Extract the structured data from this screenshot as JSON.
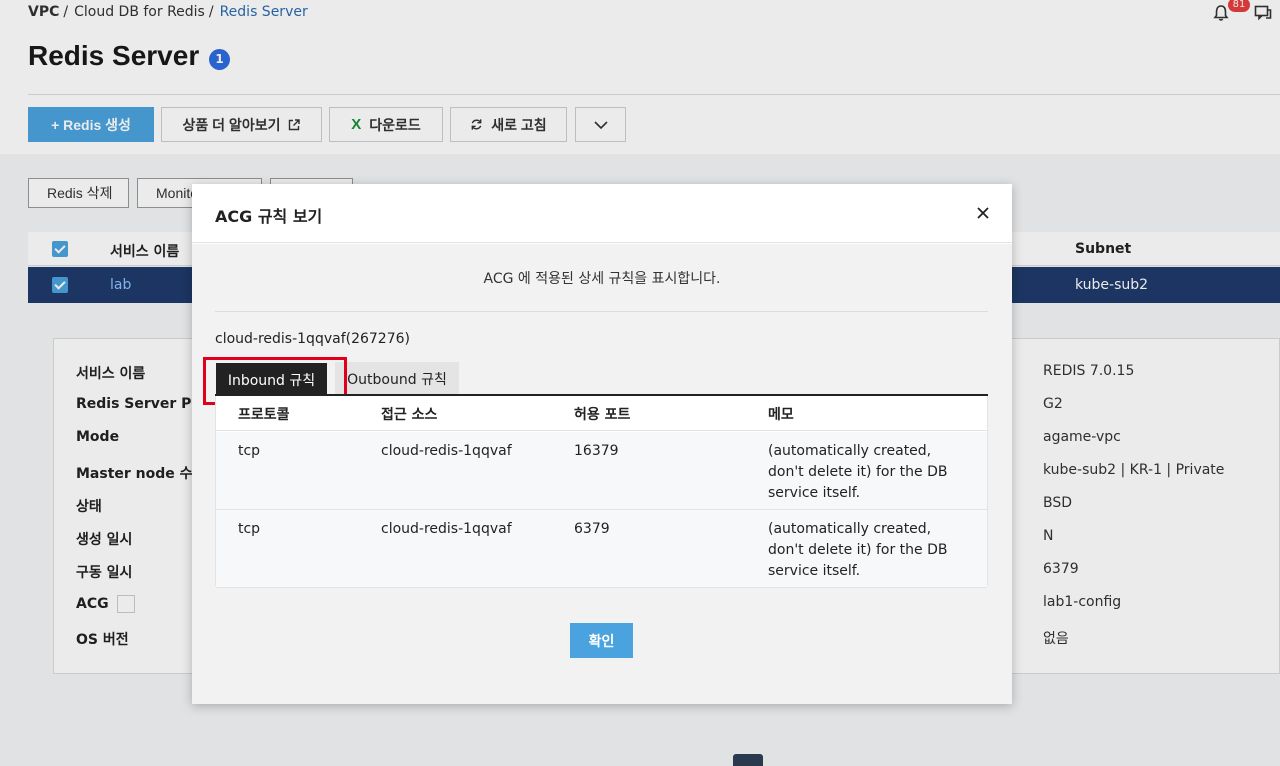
{
  "breadcrumb": {
    "items": [
      "VPC",
      "Cloud DB for Redis"
    ],
    "current": "Redis Server",
    "sep": "/"
  },
  "notifications": {
    "count": "81"
  },
  "page": {
    "title": "Redis Server",
    "title_badge": "1"
  },
  "toolbar": {
    "create": "+ Redis 생성",
    "learn_more": "상품 더 알아보기",
    "download_icon": "X",
    "download": "다운로드",
    "refresh": "새로 고침"
  },
  "subtoolbar": {
    "delete": "Redis 삭제",
    "monitoring": "Monito"
  },
  "list": {
    "headers": {
      "service_name": "서비스 이름",
      "subnet": "Subnet"
    },
    "rows": [
      {
        "name": "lab",
        "subnet": "kube-sub2"
      }
    ]
  },
  "details": {
    "labels": [
      "서비스 이름",
      "Redis Server Prefix",
      "Mode",
      "Master node 수",
      "상태",
      "생성 일시",
      "구동 일시",
      "ACG",
      "OS 버전"
    ],
    "values": [
      "REDIS 7.0.15",
      "G2",
      "agame-vpc",
      "kube-sub2 | KR-1 | Private",
      "BSD",
      "N",
      "6379",
      "lab1-config",
      "없음"
    ]
  },
  "modal": {
    "title": "ACG 규칙 보기",
    "description": "ACG 에 적용된 상세 규칙을 표시합니다.",
    "acg_name": "cloud-redis-1qqvaf(267276)",
    "tabs": {
      "inbound": "Inbound 규칙",
      "outbound": "Outbound 규칙"
    },
    "table": {
      "headers": {
        "protocol": "프로토콜",
        "source": "접근 소스",
        "port": "허용 포트",
        "memo": "메모"
      },
      "rows": [
        {
          "protocol": "tcp",
          "source": "cloud-redis-1qqvaf",
          "port": "16379",
          "memo": "(automatically created, don't delete it) for the DB service itself."
        },
        {
          "protocol": "tcp",
          "source": "cloud-redis-1qqvaf",
          "port": "6379",
          "memo": "(automatically created, don't delete it) for the DB service itself."
        }
      ]
    },
    "confirm": "확인"
  },
  "colors": {
    "accent": "#4aa3df",
    "selected_row": "#1f3a6b",
    "highlight": "#e0001b"
  }
}
